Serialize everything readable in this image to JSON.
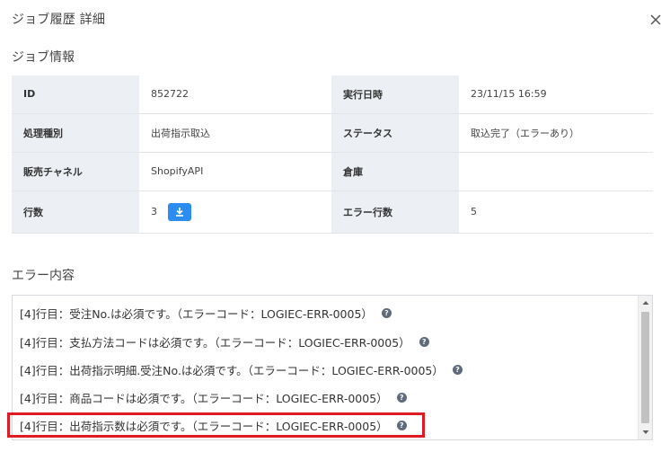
{
  "dialog": {
    "title": "ジョブ履歴 詳細",
    "close_icon": "close-icon"
  },
  "job_info": {
    "section_title": "ジョブ情報",
    "rows": [
      {
        "label1": "ID",
        "value1": "852722",
        "label2": "実行日時",
        "value2": "23/11/15 16:59"
      },
      {
        "label1": "処理種別",
        "value1": "出荷指示取込",
        "label2": "ステータス",
        "value2": "取込完了（エラーあり）"
      },
      {
        "label1": "販売チャネル",
        "value1": "ShopifyAPI",
        "label2": "倉庫",
        "value2": ""
      },
      {
        "label1": "行数",
        "value1": "3",
        "label2": "エラー行数",
        "value2": "5"
      }
    ],
    "download_icon": "download-icon"
  },
  "errors": {
    "section_title": "エラー内容",
    "lines": [
      "[4]行目：受注No.は必須です。（エラーコード：LOGIEC-ERR-0005）",
      "[4]行目：支払方法コードは必須です。（エラーコード：LOGIEC-ERR-0005）",
      "[4]行目：出荷指示明細.受注No.は必須です。（エラーコード：LOGIEC-ERR-0005）",
      "[4]行目：商品コードは必須です。（エラーコード：LOGIEC-ERR-0005）",
      "[4]行目：出荷指示数は必須です。（エラーコード：LOGIEC-ERR-0005）"
    ],
    "help_icon": "question-icon",
    "help_glyph": "?"
  },
  "colors": {
    "label_bg": "#eceff3",
    "accent_blue": "#2d8cf0",
    "highlight_red": "#e01b24"
  }
}
